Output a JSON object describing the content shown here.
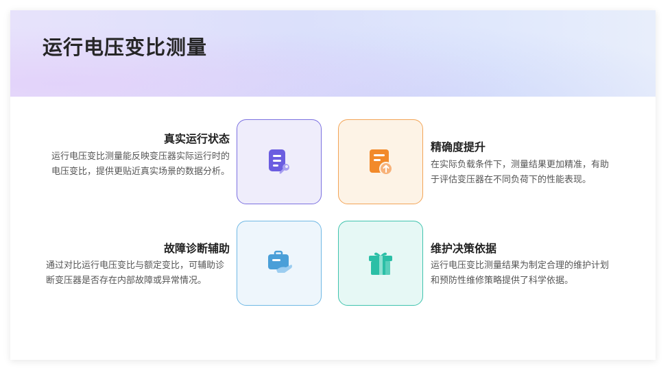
{
  "title": "运行电压变比测量",
  "items": [
    {
      "title": "真实运行状态",
      "desc": "运行电压变比测量能反映变压器实际运行时的电压变比，提供更贴近真实场景的数据分析。",
      "icon": "document-wrench-icon",
      "color": "#6b5de0"
    },
    {
      "title": "精确度提升",
      "desc": "在实际负载条件下，测量结果更加精准，有助于评估变压器在不同负荷下的性能表现。",
      "icon": "document-upload-icon",
      "color": "#f28a2a"
    },
    {
      "title": "故障诊断辅助",
      "desc": "通过对比运行电压变比与额定变比，可辅助诊断变压器是否存在内部故障或异常情况。",
      "icon": "briefcase-hand-icon",
      "color": "#4a9fd8"
    },
    {
      "title": "维护决策依据",
      "desc": "运行电压变比测量结果为制定合理的维护计划和预防性维修策略提供了科学依据。",
      "icon": "gift-box-icon",
      "color": "#2bbfa6"
    }
  ]
}
